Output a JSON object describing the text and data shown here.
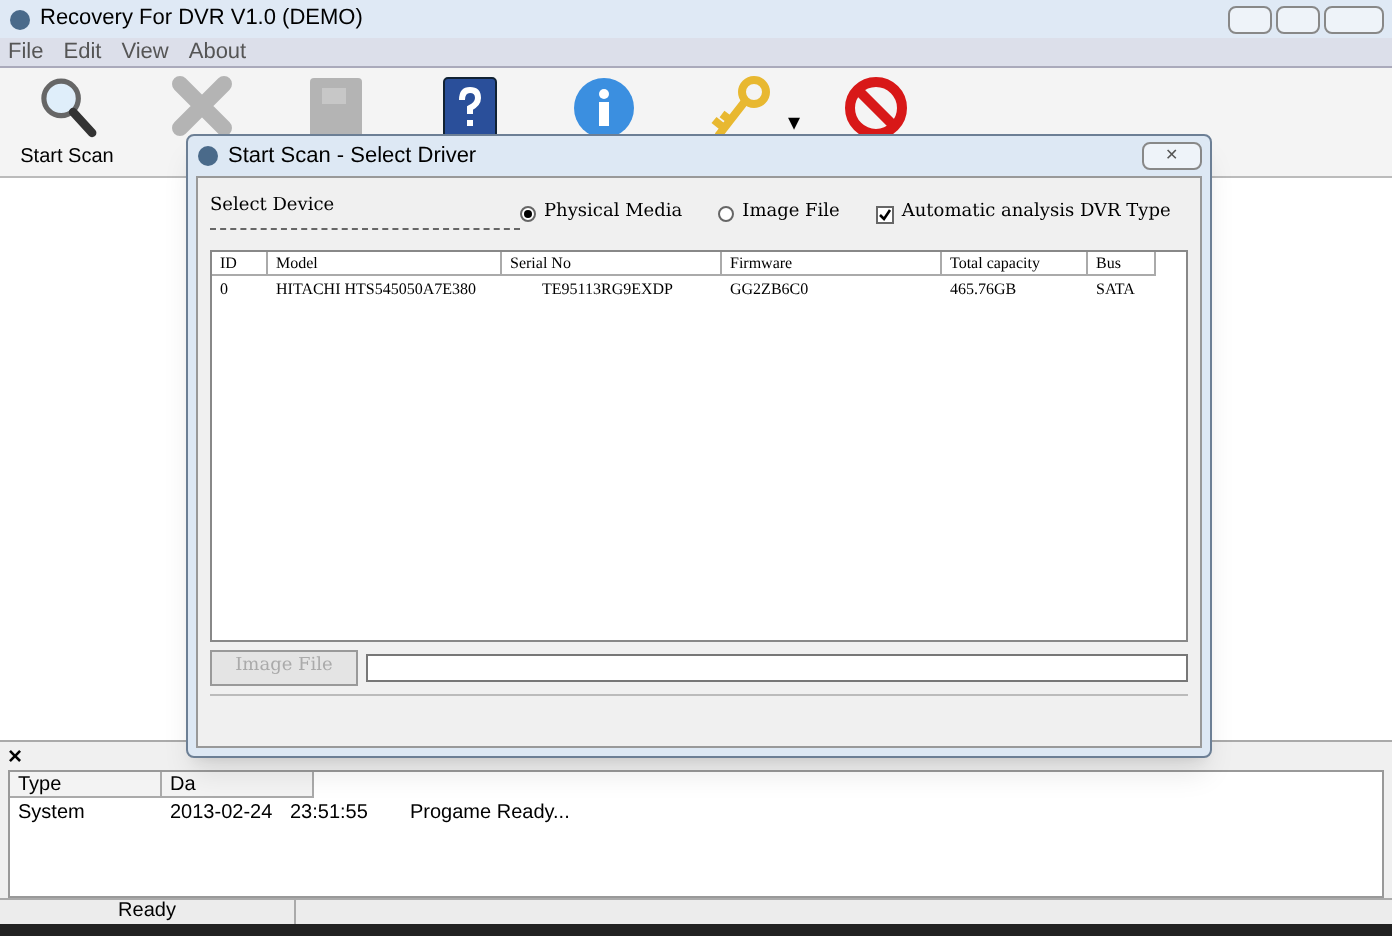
{
  "window": {
    "title": "Recovery For DVR V1.0 (DEMO)"
  },
  "menu": [
    "File",
    "Edit",
    "View",
    "About"
  ],
  "toolbar": [
    {
      "kind": "search",
      "label": "Start Scan",
      "disabled": false
    },
    {
      "kind": "stop",
      "disabled": true
    },
    {
      "kind": "disk",
      "disabled": true
    },
    {
      "kind": "help"
    },
    {
      "kind": "info"
    },
    {
      "kind": "key",
      "dropdown": "▾"
    },
    {
      "kind": "exit"
    }
  ],
  "dialog": {
    "title": "Start Scan - Select Driver",
    "close": "✕",
    "select_label": "Select Device",
    "radios": [
      {
        "label": "Physical Media",
        "selected": true
      },
      {
        "label": "Image File",
        "selected": false
      }
    ],
    "checkbox": {
      "label": "Automatic analysis DVR Type",
      "checked": true
    },
    "table": {
      "columns": [
        "ID",
        "Model",
        "Serial No",
        "Firmware",
        "Total capacity",
        "Bus"
      ],
      "rows": [
        [
          "0",
          "HITACHI HTS545050A7E380",
          "TE95113RG9EXDP",
          "GG2ZB6C0",
          "465.76GB",
          "SATA"
        ]
      ]
    },
    "image_button": {
      "label": "Image File",
      "disabled": true
    }
  },
  "log": {
    "close": "×",
    "columns": [
      "Type",
      "Da"
    ],
    "rows": [
      [
        "System",
        "2013-02-24",
        "23:51:55",
        "Progame Ready..."
      ]
    ]
  },
  "status_bar": {
    "text": "Ready"
  }
}
